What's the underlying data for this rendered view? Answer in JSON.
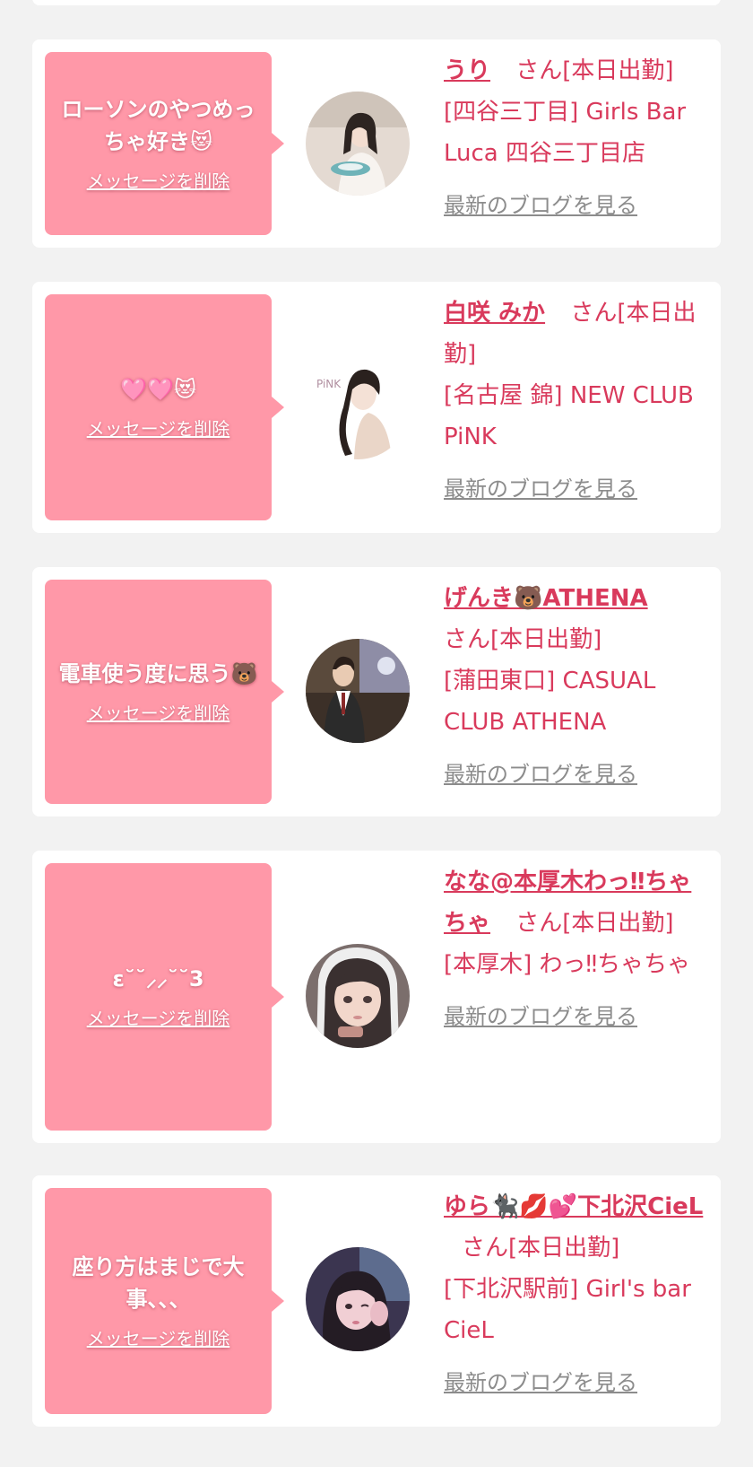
{
  "accent_color": "#ff98a8",
  "text_color": "#d93a5c",
  "link_gray": "#8c8c8c",
  "cards": [
    {
      "message": "ローソンのやつめっちゃ好き😻",
      "delete_label": "メッセージを削除",
      "name": "うり",
      "status": "さん[本日出勤]",
      "shop": "[四谷三丁目] Girls Bar Luca 四谷三丁目店",
      "blog_label": "最新のブログを見る"
    },
    {
      "message": "🩷🩷😻",
      "delete_label": "メッセージを削除",
      "name": "白咲 みか",
      "status": "さん[本日出勤]",
      "shop": "[名古屋 錦] NEW CLUB PiNK",
      "blog_label": "最新のブログを見る"
    },
    {
      "message": "電車使う度に思う🐻",
      "delete_label": "メッセージを削除",
      "name": "げんき🐻ATHENA",
      "status": "さん[本日出勤]",
      "shop": "[蒲田東口] CASUAL CLUB ATHENA",
      "blog_label": "最新のブログを見る"
    },
    {
      "message": "ε˘˘⸝⸝˘˘3",
      "delete_label": "メッセージを削除",
      "name": "なな@本厚木わっ‼ちゃちゃ",
      "status": "さん[本日出勤]",
      "shop": "[本厚木] わっ‼ちゃちゃ",
      "blog_label": "最新のブログを見る"
    },
    {
      "message": "座り方はまじで大事、、、",
      "delete_label": "メッセージを削除",
      "name": "ゆら🐈‍⬛💋💕下北沢CieL",
      "status": "さん[本日出勤]",
      "shop": "[下北沢駅前] Girl's bar CieL",
      "blog_label": "最新のブログを見る"
    }
  ]
}
